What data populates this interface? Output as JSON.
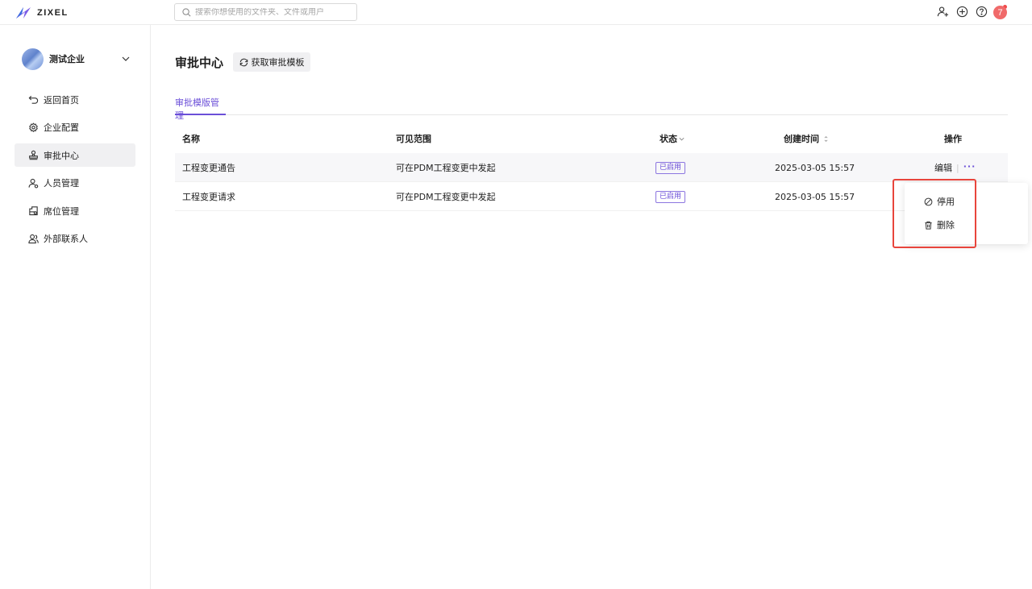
{
  "app": {
    "logo_text": "ZIXEL",
    "brand_color": "#6b4fd8"
  },
  "search": {
    "placeholder": "搜索你想使用的文件夹、文件或用户"
  },
  "topbar": {
    "icons": [
      "add-user-icon",
      "plus-circle-icon",
      "help-icon",
      "bell-icon"
    ],
    "avatar_initial": "7"
  },
  "sidebar": {
    "org_name": "测试企业",
    "items": [
      {
        "label": "返回首页",
        "icon": "back-icon",
        "active": false
      },
      {
        "label": "企业配置",
        "icon": "gear-icon",
        "active": false
      },
      {
        "label": "审批中心",
        "icon": "stamp-icon",
        "active": true
      },
      {
        "label": "人员管理",
        "icon": "users-icon",
        "active": false
      },
      {
        "label": "席位管理",
        "icon": "seat-icon",
        "active": false
      },
      {
        "label": "外部联系人",
        "icon": "contacts-icon",
        "active": false
      }
    ]
  },
  "main": {
    "title": "审批中心",
    "fetch_button": "获取审批模板",
    "tabs": [
      {
        "label": "审批模版管理",
        "active": true
      }
    ]
  },
  "table": {
    "headers": {
      "name": "名称",
      "scope": "可见范围",
      "status": "状态",
      "created": "创建时间",
      "ops": "操作"
    },
    "rows": [
      {
        "name": "工程变更通告",
        "scope": "可在PDM工程变更中发起",
        "status": "已启用",
        "created": "2025-03-05 15:57",
        "edit": "编辑",
        "more": "···"
      },
      {
        "name": "工程变更请求",
        "scope": "可在PDM工程变更中发起",
        "status": "已启用",
        "created": "2025-03-05 15:57"
      }
    ]
  },
  "dropdown": {
    "items": [
      {
        "label": "停用",
        "icon": "disable-icon"
      },
      {
        "label": "删除",
        "icon": "trash-icon"
      }
    ]
  }
}
